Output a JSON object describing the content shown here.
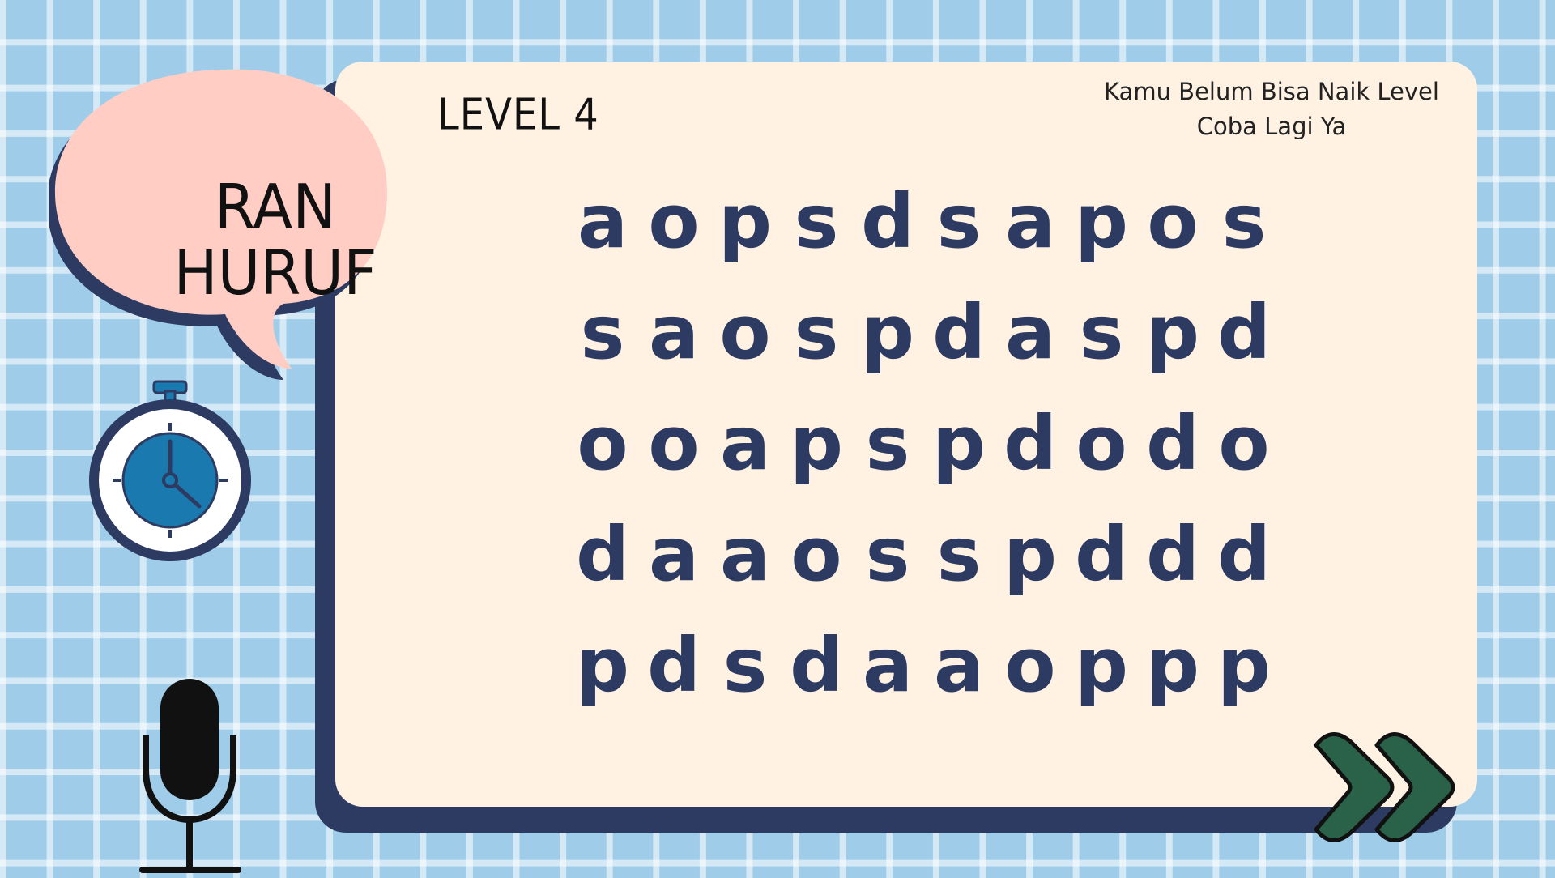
{
  "badge": {
    "line1": "RAN",
    "line2": "HURUF"
  },
  "level": {
    "title": "LEVEL 4"
  },
  "status": {
    "line1": "Kamu Belum Bisa Naik Level",
    "line2": "Coba Lagi Ya"
  },
  "letter_grid": [
    [
      "a",
      "o",
      "p",
      "s",
      "d",
      "s",
      "a",
      "p",
      "o",
      "s"
    ],
    [
      "s",
      "a",
      "o",
      "s",
      "p",
      "d",
      "a",
      "s",
      "p",
      "d"
    ],
    [
      "o",
      "o",
      "a",
      "p",
      "s",
      "p",
      "d",
      "o",
      "d",
      "o"
    ],
    [
      "d",
      "a",
      "a",
      "o",
      "s",
      "s",
      "p",
      "d",
      "d",
      "d"
    ],
    [
      "p",
      "d",
      "s",
      "d",
      "a",
      "a",
      "o",
      "p",
      "p",
      "p"
    ]
  ],
  "icons": {
    "timer": "stopwatch-icon",
    "microphone": "microphone-icon",
    "next": "double-chevron-right-icon"
  },
  "colors": {
    "background": "#9fcde9",
    "card": "#fff2e2",
    "card_shadow": "#2d3b63",
    "letters": "#2d3b63",
    "bubble": "#ffcdc4",
    "timer_face": "#1a7ab0",
    "next_button": "#2a6149"
  }
}
